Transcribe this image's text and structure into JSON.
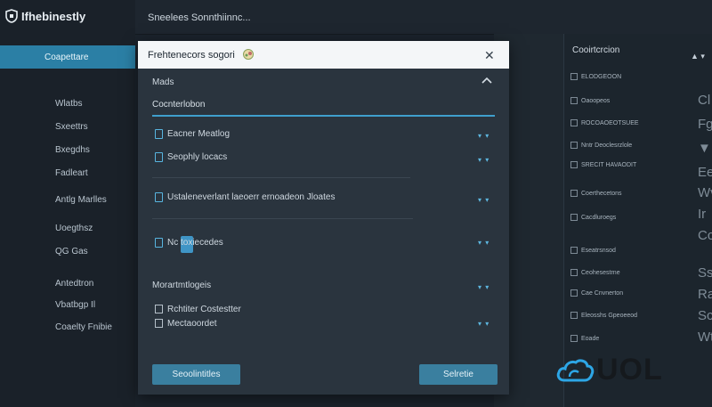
{
  "app": {
    "brand": "Ifhebinestly"
  },
  "topbar": {
    "title": "Sneelees Sonnthiinnc..."
  },
  "sidebar": {
    "active": "Coapettare",
    "items": [
      "Wlatbs",
      "Sxeettrs",
      "Bxegdhs",
      "Fadleart",
      "Antlg Marlles",
      "Uoegthsz",
      "QG Gas",
      "Antedtron",
      "Vbatbgp Il",
      "Coaelty Fnibie"
    ]
  },
  "modal": {
    "title": "Frehtenecors sogori",
    "close_label": "✕",
    "section1": "Mads",
    "tab_selected": "Cocnterlobon",
    "rows": [
      "Eacner Meatlog",
      "Seophly locacs",
      "Ustaleneverlant laeoerr ernoadeon Jloates",
      "Nc toxiecedes"
    ],
    "section2": "Morartmtlogeis",
    "sub_rows": [
      "Rchtiter Costestter",
      "Mectaoordet"
    ],
    "row_mark": "▾ ▾",
    "btn_left": "Seoolintitles",
    "btn_right": "Selretie"
  },
  "right_panel": {
    "title": "Cooirtcrcion",
    "chevron": "▲ ▾",
    "rows": [
      "ELODGEOON",
      "Oaoopeos",
      "ROCOAOEOTSUEE",
      "Nntr Deoclesrzlole",
      "SRECIT HAVAODIT",
      "Coerthecetons",
      "Cacdluroegs",
      "Eseatrsnsod",
      "Ceohesestrne",
      "Cae Cnvnerton",
      "Eleosshs Gpeoeeod",
      "Eoade"
    ],
    "big_glyphs": [
      "Cl",
      "Fg",
      "▼",
      "Ee",
      "Wv",
      "Ir",
      "Cc",
      "Ss",
      "Ra",
      "Sc",
      "Wt"
    ]
  },
  "watermark": {
    "text": "UOL"
  },
  "colors": {
    "accent": "#3f9fcd",
    "active_nav": "#2b7fa5",
    "button": "#3a7f9f"
  }
}
